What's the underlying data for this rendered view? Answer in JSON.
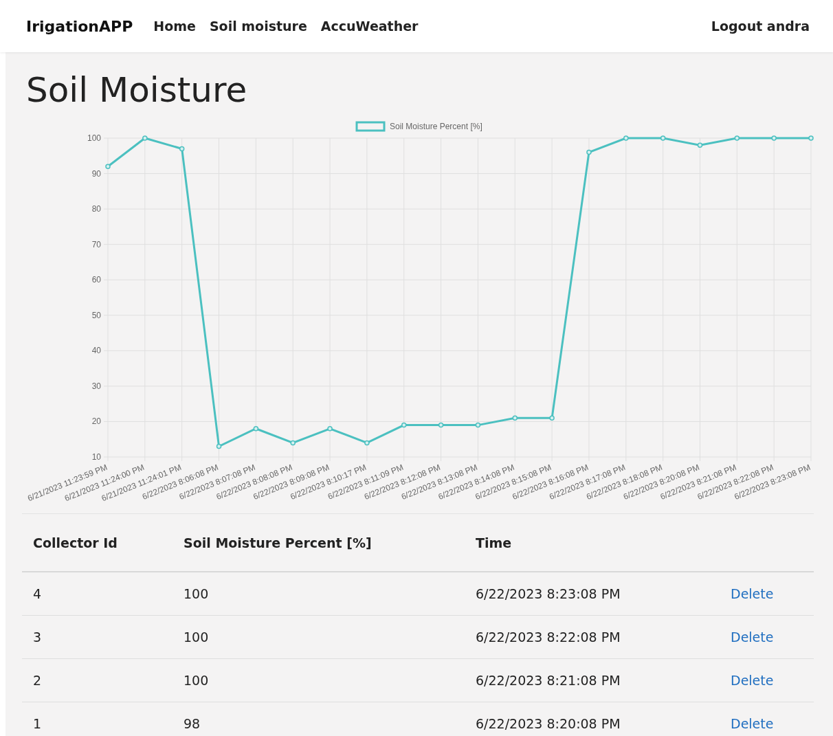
{
  "navbar": {
    "brand": "IrigationAPP",
    "links": [
      "Home",
      "Soil moisture",
      "AccuWeather"
    ],
    "logout": "Logout andra"
  },
  "title": "Soil Moisture",
  "chart_data": {
    "type": "line",
    "grid": true,
    "ylim": [
      10,
      100
    ],
    "yticks": [
      10,
      20,
      30,
      40,
      50,
      60,
      70,
      80,
      90,
      100
    ],
    "categories": [
      "6/21/2023 11:23:59 PM",
      "6/21/2023 11:24:00 PM",
      "6/21/2023 11:24:01 PM",
      "6/22/2023 8:06:08 PM",
      "6/22/2023 8:07:08 PM",
      "6/22/2023 8:08:08 PM",
      "6/22/2023 8:09:08 PM",
      "6/22/2023 8:10:17 PM",
      "6/22/2023 8:11:09 PM",
      "6/22/2023 8:12:08 PM",
      "6/22/2023 8:13:08 PM",
      "6/22/2023 8:14:08 PM",
      "6/22/2023 8:15:08 PM",
      "6/22/2023 8:16:08 PM",
      "6/22/2023 8:17:08 PM",
      "6/22/2023 8:18:08 PM",
      "6/22/2023 8:20:08 PM",
      "6/22/2023 8:21:08 PM",
      "6/22/2023 8:22:08 PM",
      "6/22/2023 8:23:08 PM"
    ],
    "series": [
      {
        "name": "Soil Moisture Percent [%]",
        "color": "#4bc0c0",
        "marker": true,
        "values": [
          92,
          100,
          97,
          13,
          18,
          14,
          18,
          14,
          19,
          19,
          19,
          21,
          21,
          96,
          100,
          100,
          98,
          100,
          100,
          100
        ]
      }
    ]
  },
  "table": {
    "columns": [
      "Collector Id",
      "Soil Moisture Percent [%]",
      "Time"
    ],
    "rows": [
      {
        "cells": [
          "4",
          "100",
          "6/22/2023 8:23:08 PM"
        ],
        "action": "Delete"
      },
      {
        "cells": [
          "3",
          "100",
          "6/22/2023 8:22:08 PM"
        ],
        "action": "Delete"
      },
      {
        "cells": [
          "2",
          "100",
          "6/22/2023 8:21:08 PM"
        ],
        "action": "Delete"
      },
      {
        "cells": [
          "1",
          "98",
          "6/22/2023 8:20:08 PM"
        ],
        "action": "Delete"
      }
    ]
  }
}
